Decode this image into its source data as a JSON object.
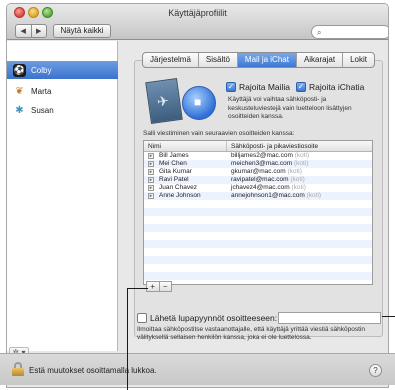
{
  "window": {
    "title": "Käyttäjäprofiilit"
  },
  "toolbar": {
    "back_glyph": "◀",
    "forward_glyph": "▶",
    "show_all_label": "Näytä kaikki",
    "search_placeholder": ""
  },
  "sidebar": {
    "users": [
      {
        "name": "Colby",
        "selected": true
      },
      {
        "name": "Marta",
        "selected": false
      },
      {
        "name": "Susan",
        "selected": false
      }
    ],
    "gear_label": "✲ ▾"
  },
  "tabs": [
    {
      "label": "Järjestelmä",
      "active": false
    },
    {
      "label": "Sisältö",
      "active": false
    },
    {
      "label": "Mail ja iChat",
      "active": true
    },
    {
      "label": "Aikarajat",
      "active": false
    },
    {
      "label": "Lokit",
      "active": false
    }
  ],
  "restrict": {
    "mail_label": "Rajoita Mailia",
    "ichat_label": "Rajoita iChatia",
    "description": "Käyttäjä voi vaihtaa sähköposti- ja keskusteluviestejä vain luetteloon lisättyjen osoitteiden kanssa."
  },
  "allow_label": "Salli viestiminen vain seuraavien osoitteiden kanssa:",
  "table": {
    "headers": [
      "Nimi",
      "Sähköposti- ja pikaviestiosoite"
    ],
    "rows": [
      {
        "name": "Bill James",
        "address": "billjames2@mac.com",
        "kind": "(koti)"
      },
      {
        "name": "Mei Chen",
        "address": "meichen3@mac.com",
        "kind": "(koti)"
      },
      {
        "name": "Gita Kumar",
        "address": "gkumar@mac.com",
        "kind": "(koti)"
      },
      {
        "name": "Ravi Patel",
        "address": "ravipatel@mac.com",
        "kind": "(koti)"
      },
      {
        "name": "Juan Chavez",
        "address": "jchavez4@mac.com",
        "kind": "(koti)"
      },
      {
        "name": "Anne Johnson",
        "address": "annejohnson1@mac.com",
        "kind": "(koti)"
      }
    ],
    "add_label": "+",
    "remove_label": "−"
  },
  "permission": {
    "label": "Lähetä lupapyynnöt osoitteeseen:",
    "value": "",
    "description": "Ilmoittaa sähköpostitse vastaanottajalle, että käyttäjä yrittää viestiä sähköpostin välityksellä sellaisen henkilön kanssa, joka ei ole luettelossa."
  },
  "footer": {
    "lock_text": "Estä muutokset osoittamalla lukkoa.",
    "help_label": "?"
  },
  "colors": {
    "selection": "#3a72cf",
    "window_bg": "#e8e8e8"
  }
}
